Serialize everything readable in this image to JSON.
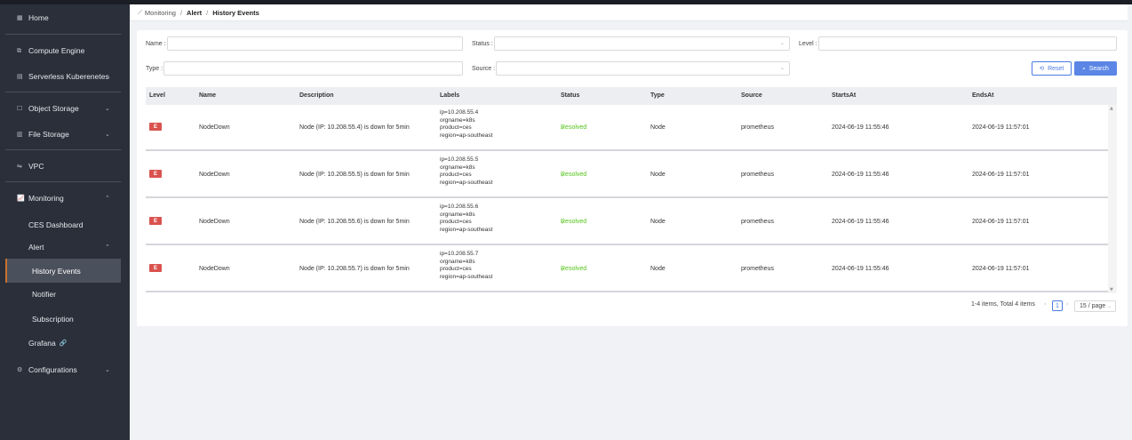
{
  "sidebar": {
    "home": "Home",
    "compute_engine": "Compute Engine",
    "serverless_kubernetes": "Serverless Kuberenetes",
    "object_storage": "Object Storage",
    "file_storage": "File Storage",
    "vpc": "VPC",
    "monitoring": "Monitoring",
    "ces_dashboard": "CES Dashboard",
    "alert": "Alert",
    "history_events": "History Events",
    "notifier": "Notifier",
    "subscription": "Subscription",
    "grafana": "Grafana",
    "configurations": "Configurations"
  },
  "breadcrumb": {
    "monitoring": "Monitoring",
    "sep": "/",
    "alert": "Alert",
    "current": "History Events"
  },
  "filters": {
    "name_label": "Name :",
    "status_label": "Status :",
    "level_label": "Level :",
    "type_label": "Type :",
    "source_label": "Source :",
    "reset": "Reset",
    "search": "Search"
  },
  "table": {
    "headers": [
      "Level",
      "Name",
      "Description",
      "Labels",
      "Status",
      "Type",
      "Source",
      "StartsAt",
      "EndsAt"
    ],
    "rows": [
      {
        "level": "E",
        "name": "NodeDown",
        "description": "Node (IP: 10.208.55.4) is down for 5min",
        "labels": [
          "ip=10.208.55.4",
          "orgname=k8s",
          "product=ces",
          "region=ap-southeast"
        ],
        "status": "Resolved",
        "type": "Node",
        "source": "prometheus",
        "starts_at": "2024-06-19 11:55:46",
        "ends_at": "2024-06-19 11:57:01"
      },
      {
        "level": "E",
        "name": "NodeDown",
        "description": "Node (IP: 10.208.55.5) is down for 5min",
        "labels": [
          "ip=10.208.55.5",
          "orgname=k8s",
          "product=ces",
          "region=ap-southeast"
        ],
        "status": "Resolved",
        "type": "Node",
        "source": "prometheus",
        "starts_at": "2024-06-19 11:55:46",
        "ends_at": "2024-06-19 11:57:01"
      },
      {
        "level": "E",
        "name": "NodeDown",
        "description": "Node (IP: 10.208.55.6) is down for 5min",
        "labels": [
          "ip=10.208.55.6",
          "orgname=k8s",
          "product=ces",
          "region=ap-southeast"
        ],
        "status": "Resolved",
        "type": "Node",
        "source": "prometheus",
        "starts_at": "2024-06-19 11:55:46",
        "ends_at": "2024-06-19 11:57:01"
      },
      {
        "level": "E",
        "name": "NodeDown",
        "description": "Node (IP: 10.208.55.7) is down for 5min",
        "labels": [
          "ip=10.208.55.7",
          "orgname=k8s",
          "product=ces",
          "region=ap-southeast"
        ],
        "status": "Resolved",
        "type": "Node",
        "source": "prometheus",
        "starts_at": "2024-06-19 11:55:46",
        "ends_at": "2024-06-19 11:57:01"
      }
    ]
  },
  "pagination": {
    "summary": "1-4 items,  Total 4 items",
    "current_page": "1",
    "page_size": "15 / page"
  },
  "colors": {
    "accent": "#5b86e5",
    "level_error": "#d9534f",
    "status_resolved": "#52c41a",
    "selected_border": "#c8722e"
  }
}
